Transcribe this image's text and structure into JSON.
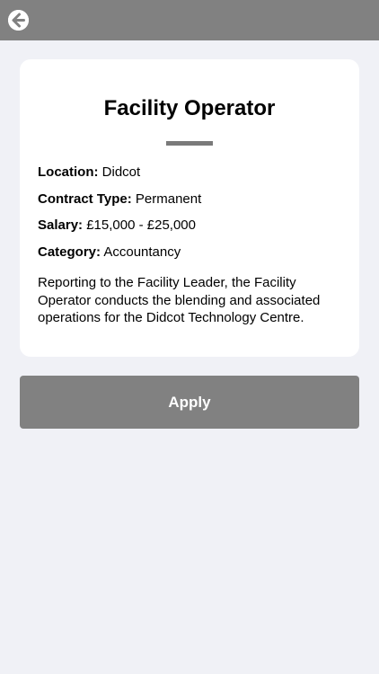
{
  "header": {
    "back_icon": "arrow-left-circle-icon"
  },
  "job": {
    "title": "Facility Operator",
    "details": [
      {
        "label": "Location:",
        "value": "Didcot"
      },
      {
        "label": "Contract Type:",
        "value": "Permanent"
      },
      {
        "label": "Salary:",
        "value": "£15,000 - £25,000"
      },
      {
        "label": "Category:",
        "value": "Accountancy"
      }
    ],
    "description": "Reporting to the Facility Leader, the Facility Operator conducts the blending and associated operations for the Didcot Technology Centre."
  },
  "actions": {
    "apply_label": "Apply"
  },
  "colors": {
    "header_bg": "#818181",
    "page_bg": "#f0f1f6",
    "card_bg": "#ffffff",
    "button_bg": "#818181"
  }
}
